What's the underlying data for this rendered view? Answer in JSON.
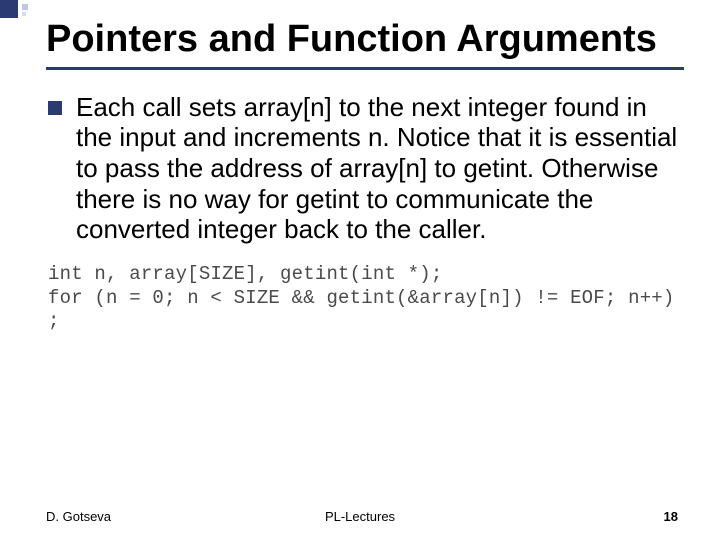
{
  "title": "Pointers and Function Arguments",
  "bullet": {
    "text": "Each call sets array[n] to the next integer found in the input and increments n. Notice that it is essential to pass the address of array[n] to getint. Otherwise there is no way for getint to communicate the converted integer back to the caller."
  },
  "code": {
    "line1": "int n, array[SIZE], getint(int *);",
    "line2": "for (n = 0; n < SIZE && getint(&array[n]) != EOF; n++)",
    "line3": "  ;"
  },
  "footer": {
    "left": "D. Gotseva",
    "center": "PL-Lectures",
    "right": "18"
  }
}
